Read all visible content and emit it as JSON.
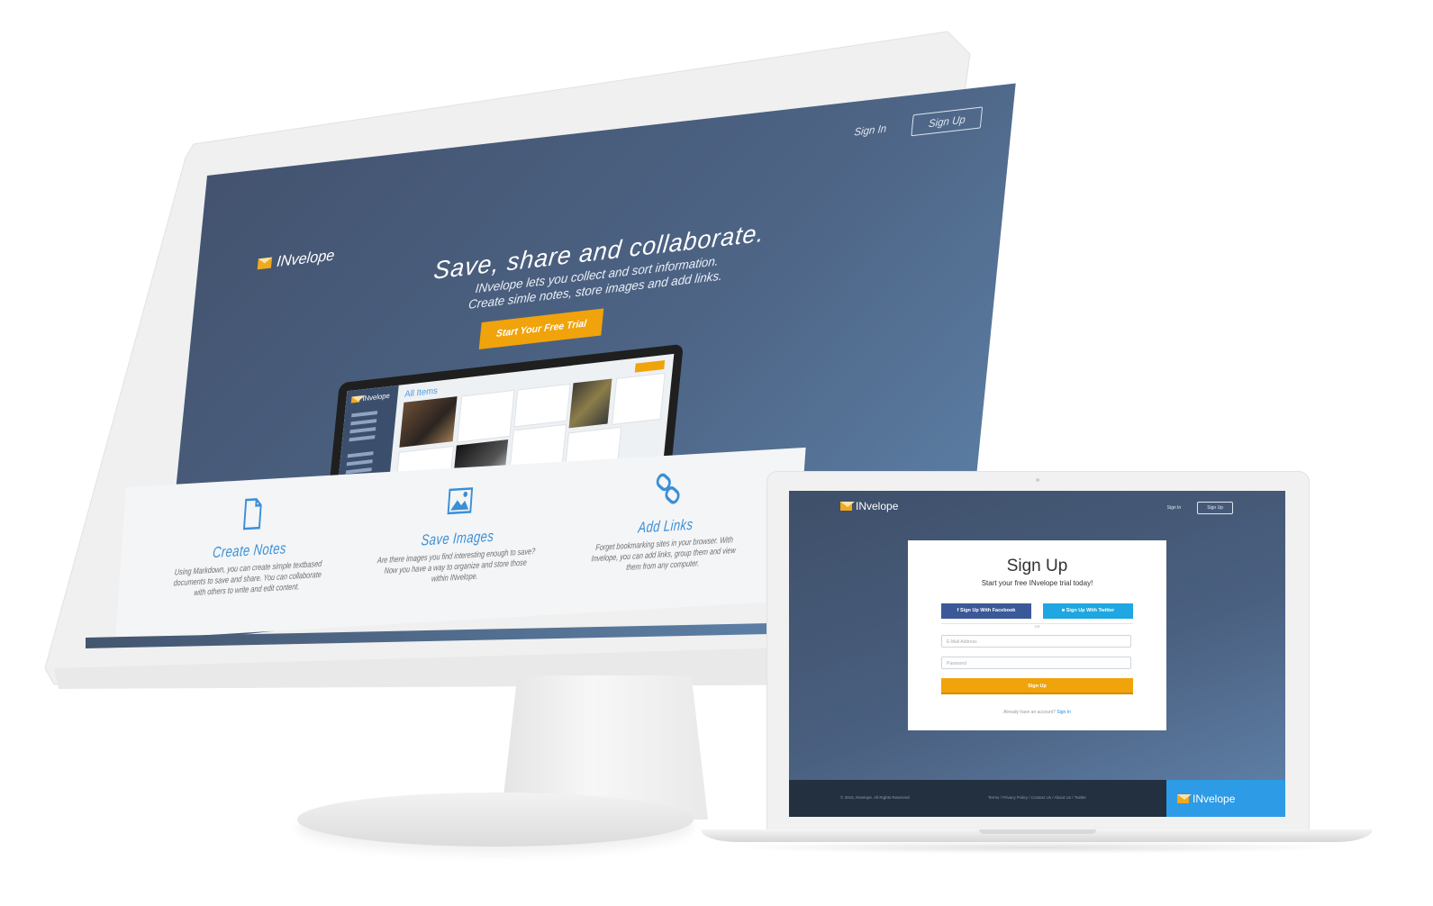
{
  "monitor": {
    "nav": {
      "signin": "Sign In",
      "signup": "Sign Up"
    },
    "logo": "INvelope",
    "hero": {
      "title": "Save, share and collaborate.",
      "line1": "INvelope lets you collect and sort information.",
      "line2": "Create simle notes, store images and add links.",
      "cta": "Start Your Free Trial"
    },
    "preview": {
      "logo": "INvelope",
      "title": "All Items"
    },
    "features": [
      {
        "title": "Create Notes",
        "text": "Using Markdown, you can create simple textbased documents to save and share. You can collaborate with others to write and edit content.",
        "icon": "document-icon"
      },
      {
        "title": "Save Images",
        "text": "Are there images you find interesting enough to save? Now you have a way to organize and store those within INvelope.",
        "icon": "image-icon"
      },
      {
        "title": "Add Links",
        "text": "Forget bookmarking sites in your browser. With Invelope, you can add links, group them and view them from any computer.",
        "icon": "link-icon"
      }
    ]
  },
  "laptop": {
    "logo": "INvelope",
    "nav": {
      "signin": "Sign In",
      "signup": "Sign Up"
    },
    "card": {
      "title": "Sign Up",
      "subtitle": "Start your free INvelope trial today!",
      "facebook": "Sign Up With Facebook",
      "twitter": "Sign Up With Twitter",
      "or": "OR",
      "email_placeholder": "E-Mail Address",
      "password_placeholder": "Password",
      "submit": "Sign Up",
      "already": "Already have an account?",
      "signin_link": "Sign In"
    },
    "footer": {
      "copyright": "© 2015, INvelope. All Rights Reserved",
      "links": "Terms / Privacy Policy / Contact Us / About Us / Twitter",
      "brand": "INvelope"
    }
  },
  "colors": {
    "accent": "#f0a30a",
    "brand_blue": "#2d9be6",
    "hero_bg": "#4d6485",
    "link_blue": "#3a8fd6"
  }
}
